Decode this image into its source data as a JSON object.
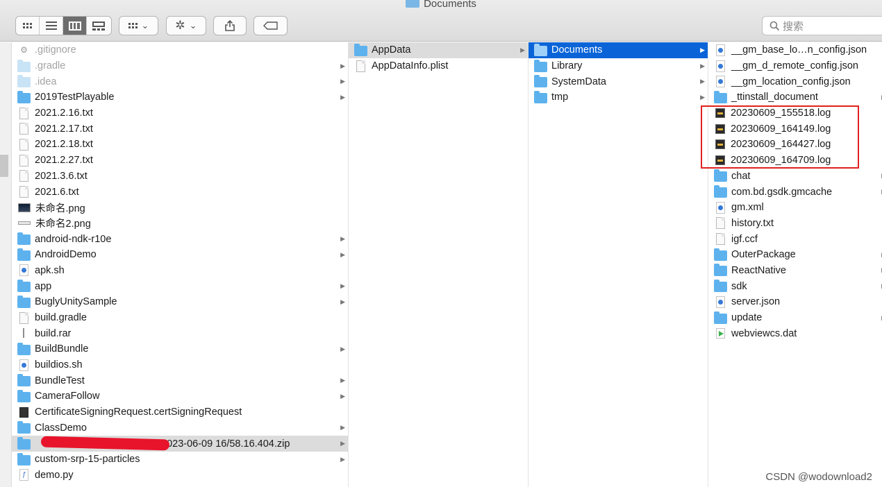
{
  "window": {
    "title": "Documents"
  },
  "toolbar": {
    "view_icon": "icon-view-button",
    "list_icon": "list-view-button",
    "column_icon": "column-view-button",
    "gallery_icon": "gallery-view-button",
    "group_icon": "group-by-button",
    "action_icon": "gear-icon",
    "share_icon": "share-icon",
    "tag_icon": "tag-icon",
    "search_placeholder": "搜索"
  },
  "column1": {
    "items": [
      {
        "name": ".gitignore",
        "icon": "gear-icon",
        "dim": true,
        "arrow": false
      },
      {
        "name": ".gradle",
        "icon": "folder-icon",
        "dim": true,
        "arrow": true
      },
      {
        "name": ".idea",
        "icon": "folder-icon",
        "dim": true,
        "arrow": true
      },
      {
        "name": "2019TestPlayable",
        "icon": "folder-icon",
        "dim": false,
        "arrow": true
      },
      {
        "name": "2021.2.16.txt",
        "icon": "text-file-icon",
        "dim": false,
        "arrow": false
      },
      {
        "name": "2021.2.17.txt",
        "icon": "text-file-icon",
        "dim": false,
        "arrow": false
      },
      {
        "name": "2021.2.18.txt",
        "icon": "text-file-icon",
        "dim": false,
        "arrow": false
      },
      {
        "name": "2021.2.27.txt",
        "icon": "text-file-icon",
        "dim": false,
        "arrow": false
      },
      {
        "name": "2021.3.6.txt",
        "icon": "text-file-icon",
        "dim": false,
        "arrow": false
      },
      {
        "name": "2021.6.txt",
        "icon": "text-file-icon",
        "dim": false,
        "arrow": false
      },
      {
        "name": "未命名.png",
        "icon": "image-icon",
        "dim": false,
        "arrow": false
      },
      {
        "name": "未命名2.png",
        "icon": "image-icon",
        "dim": false,
        "arrow": false
      },
      {
        "name": "android-ndk-r10e",
        "icon": "folder-icon",
        "dim": false,
        "arrow": true
      },
      {
        "name": "AndroidDemo",
        "icon": "folder-icon",
        "dim": false,
        "arrow": true
      },
      {
        "name": "apk.sh",
        "icon": "script-icon",
        "dim": false,
        "arrow": false
      },
      {
        "name": "app",
        "icon": "folder-icon",
        "dim": false,
        "arrow": true
      },
      {
        "name": "BuglyUnitySample",
        "icon": "folder-icon",
        "dim": false,
        "arrow": true
      },
      {
        "name": "build.gradle",
        "icon": "document-icon",
        "dim": false,
        "arrow": false
      },
      {
        "name": "build.rar",
        "icon": "archive-icon",
        "dim": false,
        "arrow": false
      },
      {
        "name": "BuildBundle",
        "icon": "folder-icon",
        "dim": false,
        "arrow": true
      },
      {
        "name": "buildios.sh",
        "icon": "script-icon",
        "dim": false,
        "arrow": false
      },
      {
        "name": "BundleTest",
        "icon": "folder-icon",
        "dim": false,
        "arrow": true
      },
      {
        "name": "CameraFollow",
        "icon": "folder-icon",
        "dim": false,
        "arrow": true
      },
      {
        "name": "CertificateSigningRequest.certSigningRequest",
        "icon": "certificate-icon",
        "dim": false,
        "arrow": false
      },
      {
        "name": "ClassDemo",
        "icon": "folder-icon",
        "dim": false,
        "arrow": true
      },
      {
        "name": "2023-06-09 16/58.16.404.zip",
        "icon": "folder-icon",
        "dim": false,
        "arrow": true,
        "selected": true,
        "redacted": true
      },
      {
        "name": "custom-srp-15-particles",
        "icon": "folder-icon",
        "dim": false,
        "arrow": true
      },
      {
        "name": "demo.py",
        "icon": "python-icon",
        "dim": false,
        "arrow": false
      }
    ]
  },
  "column2": {
    "items": [
      {
        "name": "AppData",
        "icon": "folder-icon",
        "arrow": true,
        "selected": true
      },
      {
        "name": "AppDataInfo.plist",
        "icon": "document-icon",
        "arrow": false
      }
    ]
  },
  "column3": {
    "items": [
      {
        "name": "Documents",
        "icon": "folder-icon",
        "arrow": true,
        "active": true
      },
      {
        "name": "Library",
        "icon": "folder-icon",
        "arrow": true
      },
      {
        "name": "SystemData",
        "icon": "folder-icon",
        "arrow": true
      },
      {
        "name": "tmp",
        "icon": "folder-icon",
        "arrow": true
      }
    ]
  },
  "column4": {
    "items": [
      {
        "name": "__gm_base_lo…n_config.json",
        "icon": "script-icon",
        "arrow": false
      },
      {
        "name": "__gm_d_remote_config.json",
        "icon": "script-icon",
        "arrow": false
      },
      {
        "name": "__gm_location_config.json",
        "icon": "script-icon",
        "arrow": false
      },
      {
        "name": "_ttinstall_document",
        "icon": "folder-icon",
        "arrow": true
      },
      {
        "name": "20230609_155518.log",
        "icon": "log-icon",
        "arrow": false
      },
      {
        "name": "20230609_164149.log",
        "icon": "log-icon",
        "arrow": false
      },
      {
        "name": "20230609_164427.log",
        "icon": "log-icon",
        "arrow": false
      },
      {
        "name": "20230609_164709.log",
        "icon": "log-icon",
        "arrow": false
      },
      {
        "name": "chat",
        "icon": "folder-icon",
        "arrow": true
      },
      {
        "name": "com.bd.gsdk.gmcache",
        "icon": "folder-icon",
        "arrow": true
      },
      {
        "name": "gm.xml",
        "icon": "script-icon",
        "arrow": false
      },
      {
        "name": "history.txt",
        "icon": "text-file-icon",
        "arrow": false
      },
      {
        "name": "igf.ccf",
        "icon": "document-icon",
        "arrow": false
      },
      {
        "name": "OuterPackage",
        "icon": "folder-icon",
        "arrow": true
      },
      {
        "name": "ReactNative",
        "icon": "folder-icon",
        "arrow": true
      },
      {
        "name": "sdk",
        "icon": "folder-icon",
        "arrow": true
      },
      {
        "name": "server.json",
        "icon": "script-icon",
        "arrow": false
      },
      {
        "name": "update",
        "icon": "folder-icon",
        "arrow": true
      },
      {
        "name": "webviewcs.dat",
        "icon": "media-file-icon",
        "arrow": false
      }
    ]
  },
  "watermark": "CSDN @wodownload2",
  "colors": {
    "selection_blue": "#0a64d8",
    "folder_blue": "#5db2ee",
    "highlight_red": "#e02020"
  }
}
